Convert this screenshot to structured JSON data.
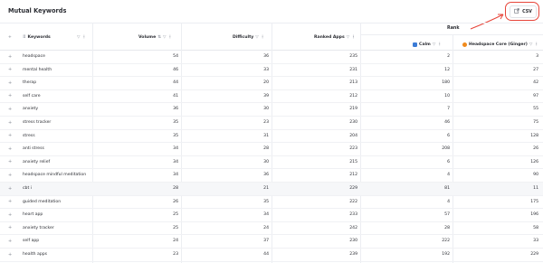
{
  "page": {
    "title": "Mutual Keywords"
  },
  "toolbar": {
    "csv_label": "CSV"
  },
  "table": {
    "group_header": "Rank",
    "columns": {
      "keywords": "Keywords",
      "volume": "Volume",
      "difficulty": "Difficulty",
      "ranked_apps": "Ranked Apps",
      "app1": "Calm",
      "app2": "Headspace Core (Ginger)"
    },
    "app_colors": {
      "app1": "#3b7bd6",
      "app2": "#f08a1c"
    },
    "rows": [
      {
        "keyword": "headspace",
        "volume": "54",
        "difficulty": "36",
        "ranked_apps": "235",
        "app1": "2",
        "app2": "3"
      },
      {
        "keyword": "mental health",
        "volume": "46",
        "difficulty": "33",
        "ranked_apps": "231",
        "app1": "12",
        "app2": "27"
      },
      {
        "keyword": "therap",
        "volume": "44",
        "difficulty": "20",
        "ranked_apps": "213",
        "app1": "180",
        "app2": "42"
      },
      {
        "keyword": "self care",
        "volume": "41",
        "difficulty": "39",
        "ranked_apps": "212",
        "app1": "10",
        "app2": "97"
      },
      {
        "keyword": "anxiety",
        "volume": "36",
        "difficulty": "30",
        "ranked_apps": "219",
        "app1": "7",
        "app2": "55"
      },
      {
        "keyword": "stress tracker",
        "volume": "35",
        "difficulty": "23",
        "ranked_apps": "230",
        "app1": "46",
        "app2": "75"
      },
      {
        "keyword": "stress",
        "volume": "35",
        "difficulty": "31",
        "ranked_apps": "204",
        "app1": "6",
        "app2": "128"
      },
      {
        "keyword": "anti stress",
        "volume": "34",
        "difficulty": "28",
        "ranked_apps": "223",
        "app1": "208",
        "app2": "26"
      },
      {
        "keyword": "anxiety relief",
        "volume": "34",
        "difficulty": "30",
        "ranked_apps": "215",
        "app1": "6",
        "app2": "126"
      },
      {
        "keyword": "headspace mindful meditation",
        "volume": "34",
        "difficulty": "36",
        "ranked_apps": "212",
        "app1": "4",
        "app2": "90"
      },
      {
        "keyword": "cbt i",
        "volume": "28",
        "difficulty": "21",
        "ranked_apps": "229",
        "app1": "81",
        "app2": "11"
      },
      {
        "keyword": "guided meditation",
        "volume": "26",
        "difficulty": "35",
        "ranked_apps": "222",
        "app1": "4",
        "app2": "175"
      },
      {
        "keyword": "heart app",
        "volume": "25",
        "difficulty": "34",
        "ranked_apps": "233",
        "app1": "57",
        "app2": "196"
      },
      {
        "keyword": "anxiety tracker",
        "volume": "25",
        "difficulty": "24",
        "ranked_apps": "242",
        "app1": "28",
        "app2": "58"
      },
      {
        "keyword": "self app",
        "volume": "24",
        "difficulty": "37",
        "ranked_apps": "230",
        "app1": "222",
        "app2": "33"
      },
      {
        "keyword": "health apps",
        "volume": "23",
        "difficulty": "44",
        "ranked_apps": "239",
        "app1": "192",
        "app2": "229"
      }
    ],
    "highlighted_row": 10
  }
}
